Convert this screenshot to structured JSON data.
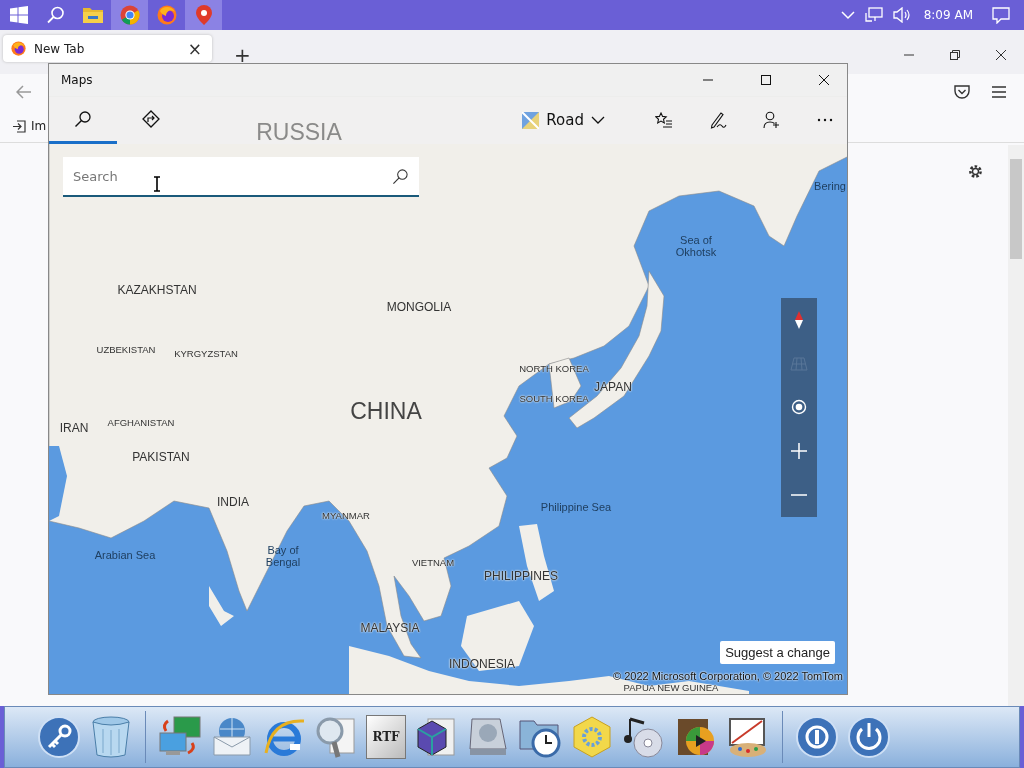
{
  "taskbar": {
    "apps": [
      {
        "kind": "start",
        "highlighted": false
      },
      {
        "kind": "search",
        "highlighted": false
      },
      {
        "kind": "folder",
        "highlighted": false
      },
      {
        "kind": "chrome",
        "highlighted": true
      },
      {
        "kind": "firefox",
        "highlighted": false
      },
      {
        "kind": "maps",
        "highlighted": true
      }
    ],
    "time": "8:09 AM"
  },
  "browser": {
    "tab": {
      "title": "New Tab",
      "close": "×"
    },
    "new_tab": "+",
    "bookmark": "Im"
  },
  "maps": {
    "window": {
      "title": "Maps"
    },
    "tabs": [
      {
        "kind": "search",
        "selected": true
      },
      {
        "kind": "directions",
        "selected": false
      }
    ],
    "map_style": "Road",
    "search": {
      "placeholder": "Search"
    },
    "labels": [
      {
        "text": "RUSSIA",
        "kind": "country-faded"
      },
      {
        "text": "Bering",
        "kind": "sea"
      },
      {
        "text": "Sea of Okhotsk",
        "kind": "sea-stacked"
      },
      {
        "text": "KAZAKHSTAN",
        "kind": "country"
      },
      {
        "text": "MONGOLIA",
        "kind": "country"
      },
      {
        "text": "UZBEKISTAN",
        "kind": "country-small"
      },
      {
        "text": "KYRGYZSTAN",
        "kind": "country-small"
      },
      {
        "text": "NORTH KOREA",
        "kind": "country-small"
      },
      {
        "text": "JAPAN",
        "kind": "country"
      },
      {
        "text": "SOUTH KOREA",
        "kind": "country-small"
      },
      {
        "text": "CHINA",
        "kind": "country-large"
      },
      {
        "text": "AFGHANISTAN",
        "kind": "country-small"
      },
      {
        "text": "IRAN",
        "kind": "country"
      },
      {
        "text": "PAKISTAN",
        "kind": "country"
      },
      {
        "text": "INDIA",
        "kind": "country"
      },
      {
        "text": "Philippine Sea",
        "kind": "sea"
      },
      {
        "text": "MYANMAR",
        "kind": "country-small"
      },
      {
        "text": "Arabian Sea",
        "kind": "sea"
      },
      {
        "text": "Bay of Bengal",
        "kind": "sea-stacked"
      },
      {
        "text": "VIETNAM",
        "kind": "country-small"
      },
      {
        "text": "PHILIPPINES",
        "kind": "country"
      },
      {
        "text": "MALAYSIA",
        "kind": "country"
      },
      {
        "text": "INDONESIA",
        "kind": "country"
      },
      {
        "text": "PAPUA NEW GUINEA",
        "kind": "country-small"
      }
    ],
    "controls": [
      {
        "kind": "compass",
        "disabled": false
      },
      {
        "kind": "tilt",
        "disabled": true
      },
      {
        "kind": "locate",
        "disabled": false
      },
      {
        "kind": "zoom-in",
        "disabled": false
      },
      {
        "kind": "zoom-out",
        "disabled": false
      }
    ],
    "suggest_button": "Suggest a change",
    "attribution": "© 2022 Microsoft Corporation, © 2022 TomTom"
  },
  "dock": {
    "icons": [
      {
        "kind": "key"
      },
      {
        "kind": "trash"
      },
      {
        "kind": "separator"
      },
      {
        "kind": "network"
      },
      {
        "kind": "mail"
      },
      {
        "kind": "browser"
      },
      {
        "kind": "find"
      },
      {
        "kind": "document",
        "text": "RTF"
      },
      {
        "kind": "cube"
      },
      {
        "kind": "disk"
      },
      {
        "kind": "clock"
      },
      {
        "kind": "gear"
      },
      {
        "kind": "music"
      },
      {
        "kind": "video"
      },
      {
        "kind": "paint"
      },
      {
        "kind": "separator"
      },
      {
        "kind": "logout"
      },
      {
        "kind": "power"
      }
    ]
  }
}
